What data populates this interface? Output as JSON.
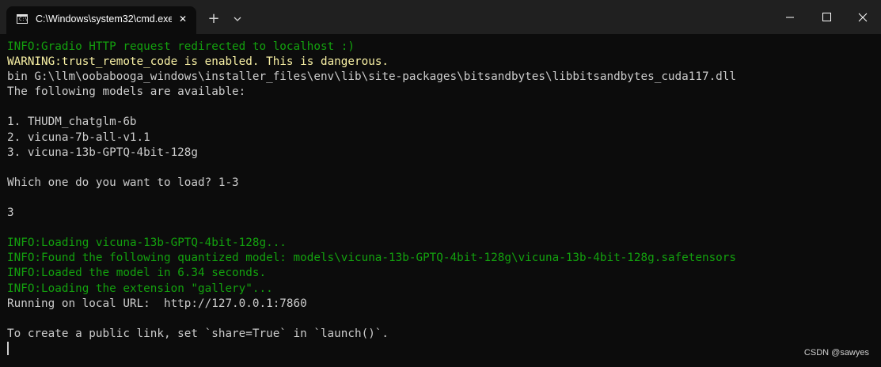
{
  "window": {
    "tab_title": "C:\\Windows\\system32\\cmd.exe",
    "new_tab_label": "+",
    "close_tab_label": "✕"
  },
  "colors": {
    "info": "#13a10e",
    "warning": "#f9f1a5",
    "default": "#cccccc",
    "background": "#0c0c0c",
    "titlebar": "#202020"
  },
  "terminal": {
    "lines": [
      {
        "prefix": "INFO:",
        "text": "Gradio HTTP request redirected to localhost :)",
        "style": "green"
      },
      {
        "prefix": "WARNING:",
        "text": "trust_remote_code is enabled. This is dangerous.",
        "style": "yellow"
      },
      {
        "prefix": "",
        "text": "bin G:\\llm\\oobabooga_windows\\installer_files\\env\\lib\\site-packages\\bitsandbytes\\libbitsandbytes_cuda117.dll",
        "style": "white"
      },
      {
        "prefix": "",
        "text": "The following models are available:",
        "style": "white"
      },
      {
        "prefix": "",
        "text": "",
        "style": "white"
      },
      {
        "prefix": "",
        "text": "1. THUDM_chatglm-6b",
        "style": "white"
      },
      {
        "prefix": "",
        "text": "2. vicuna-7b-all-v1.1",
        "style": "white"
      },
      {
        "prefix": "",
        "text": "3. vicuna-13b-GPTQ-4bit-128g",
        "style": "white"
      },
      {
        "prefix": "",
        "text": "",
        "style": "white"
      },
      {
        "prefix": "",
        "text": "Which one do you want to load? 1-3",
        "style": "white"
      },
      {
        "prefix": "",
        "text": "",
        "style": "white"
      },
      {
        "prefix": "",
        "text": "3",
        "style": "white"
      },
      {
        "prefix": "",
        "text": "",
        "style": "white"
      },
      {
        "prefix": "INFO:",
        "text": "Loading vicuna-13b-GPTQ-4bit-128g...",
        "style": "green"
      },
      {
        "prefix": "INFO:",
        "text": "Found the following quantized model: models\\vicuna-13b-GPTQ-4bit-128g\\vicuna-13b-4bit-128g.safetensors",
        "style": "green"
      },
      {
        "prefix": "INFO:",
        "text": "Loaded the model in 6.34 seconds.",
        "style": "green"
      },
      {
        "prefix": "INFO:",
        "text": "Loading the extension \"gallery\"...",
        "style": "green"
      },
      {
        "prefix": "",
        "text": "Running on local URL:  http://127.0.0.1:7860",
        "style": "white"
      },
      {
        "prefix": "",
        "text": "",
        "style": "white"
      },
      {
        "prefix": "",
        "text": "To create a public link, set `share=True` in `launch()`.",
        "style": "white"
      }
    ]
  },
  "watermark": "CSDN @sawyes"
}
